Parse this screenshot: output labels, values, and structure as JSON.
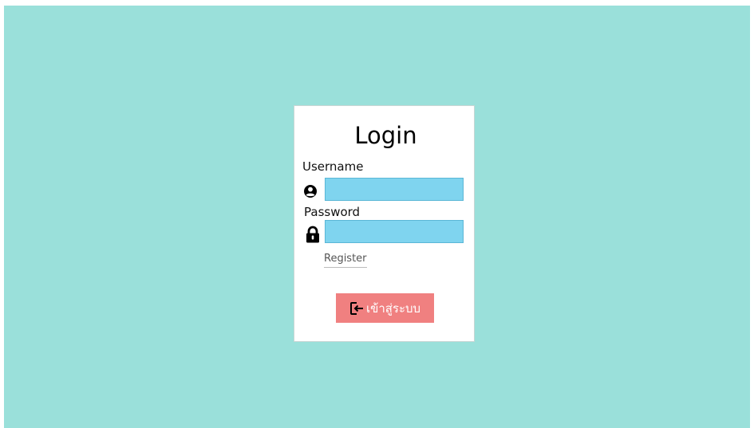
{
  "form": {
    "title": "Login",
    "username_label": "Username",
    "username_value": "",
    "password_label": "Password",
    "password_value": "",
    "register_link": "Register",
    "submit_label": "เข้าสู่ระบบ"
  },
  "icons": {
    "username": "user-circle-icon",
    "password": "lock-icon",
    "submit": "sign-in-icon"
  },
  "colors": {
    "background": "#9ae0da",
    "card": "#ffffff",
    "input": "#7fd4ef",
    "button": "#f08080"
  }
}
